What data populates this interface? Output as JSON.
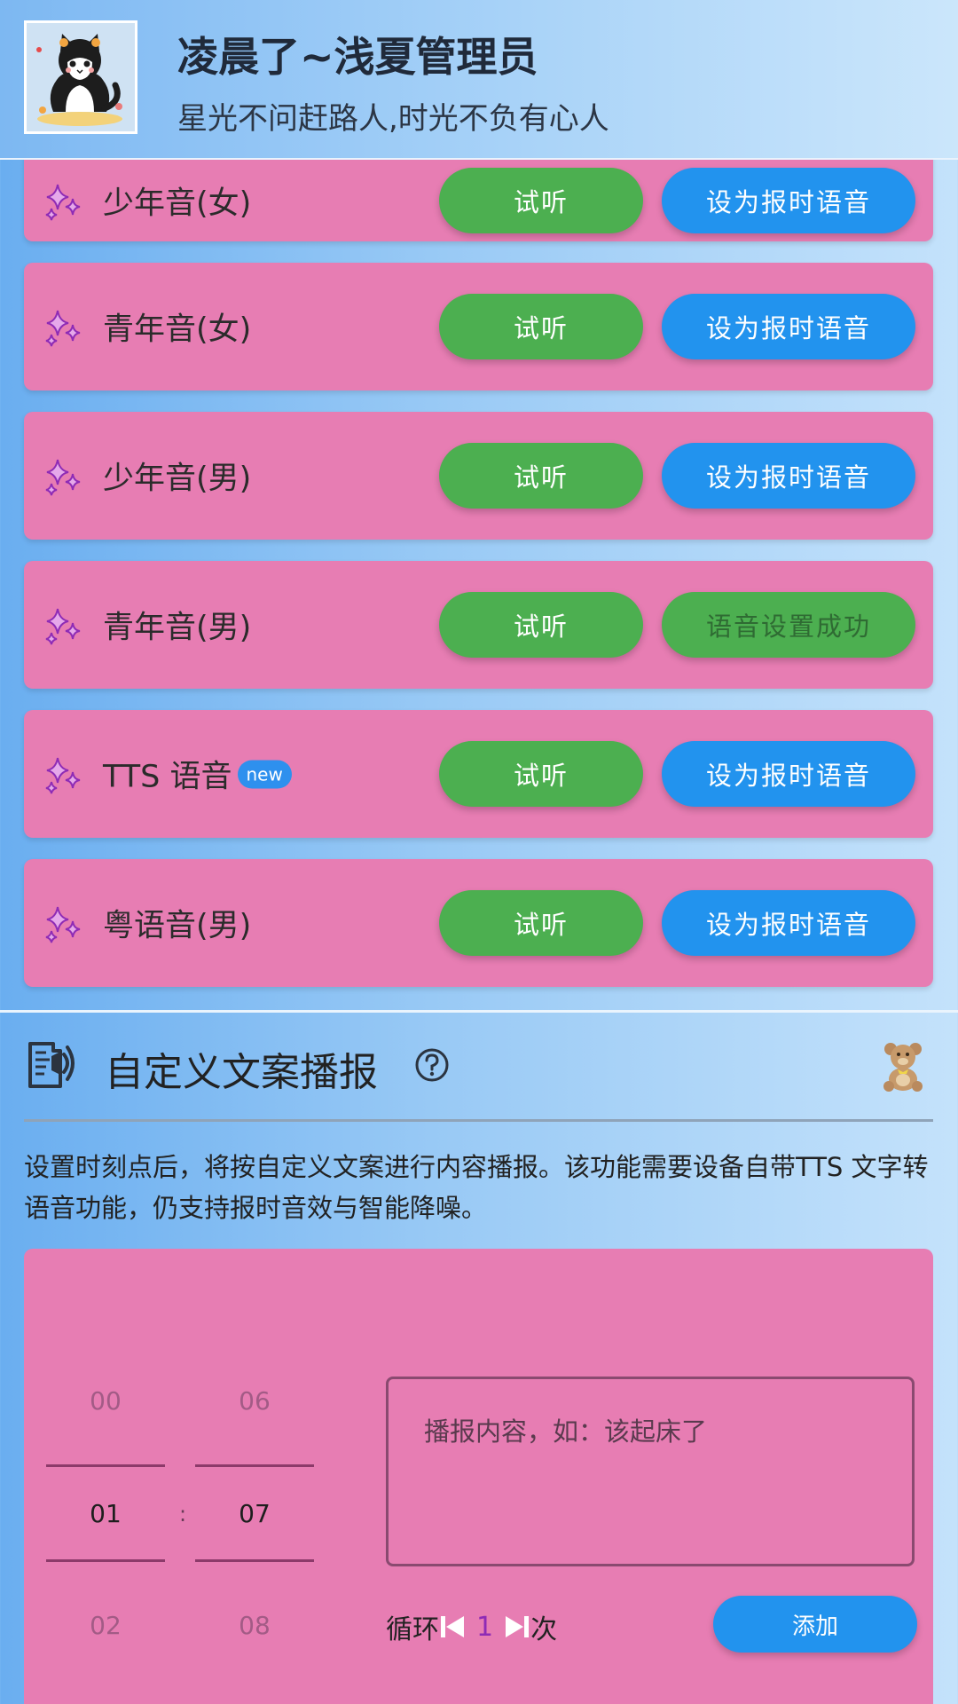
{
  "header": {
    "title": "凌晨了~浅夏管理员",
    "subtitle": "星光不问赶路人,时光不负有心人"
  },
  "voices": [
    {
      "name": "少年音(女)",
      "listen_label": "试听",
      "set_label": "设为报时语音",
      "status": "default"
    },
    {
      "name": "青年音(女)",
      "listen_label": "试听",
      "set_label": "设为报时语音",
      "status": "default"
    },
    {
      "name": "少年音(男)",
      "listen_label": "试听",
      "set_label": "设为报时语音",
      "status": "default"
    },
    {
      "name": "青年音(男)",
      "listen_label": "试听",
      "set_label": "语音设置成功",
      "status": "success"
    },
    {
      "name": "TTS 语音",
      "badge": "new",
      "listen_label": "试听",
      "set_label": "设为报时语音",
      "status": "default"
    },
    {
      "name": "粤语音(男)",
      "listen_label": "试听",
      "set_label": "设为报时语音",
      "status": "default"
    }
  ],
  "custom_section": {
    "title": "自定义文案播报",
    "description": "设置时刻点后，将按自定义文案进行内容播报。该功能需要设备自带TTS 文字转语音功能，仍支持报时音效与智能降噪。",
    "time_picker": {
      "hours": [
        "00",
        "01",
        "02"
      ],
      "minutes": [
        "06",
        "07",
        "08"
      ],
      "selected_hour": "01",
      "selected_minute": "07",
      "separator": ":"
    },
    "content_placeholder": "播报内容，如：该起床了",
    "loop_label": "循环",
    "loop_count": "1",
    "loop_suffix": "次",
    "add_label": "添加"
  },
  "colors": {
    "card": "#e77db3",
    "listen_button": "#4caf50",
    "set_button": "#2293ee",
    "badge": "#2e90ee"
  },
  "icons": [
    "sparkle-icon",
    "speaker-doc-icon",
    "help-icon",
    "teddy-bear-icon",
    "skip-previous-icon",
    "skip-next-icon"
  ]
}
